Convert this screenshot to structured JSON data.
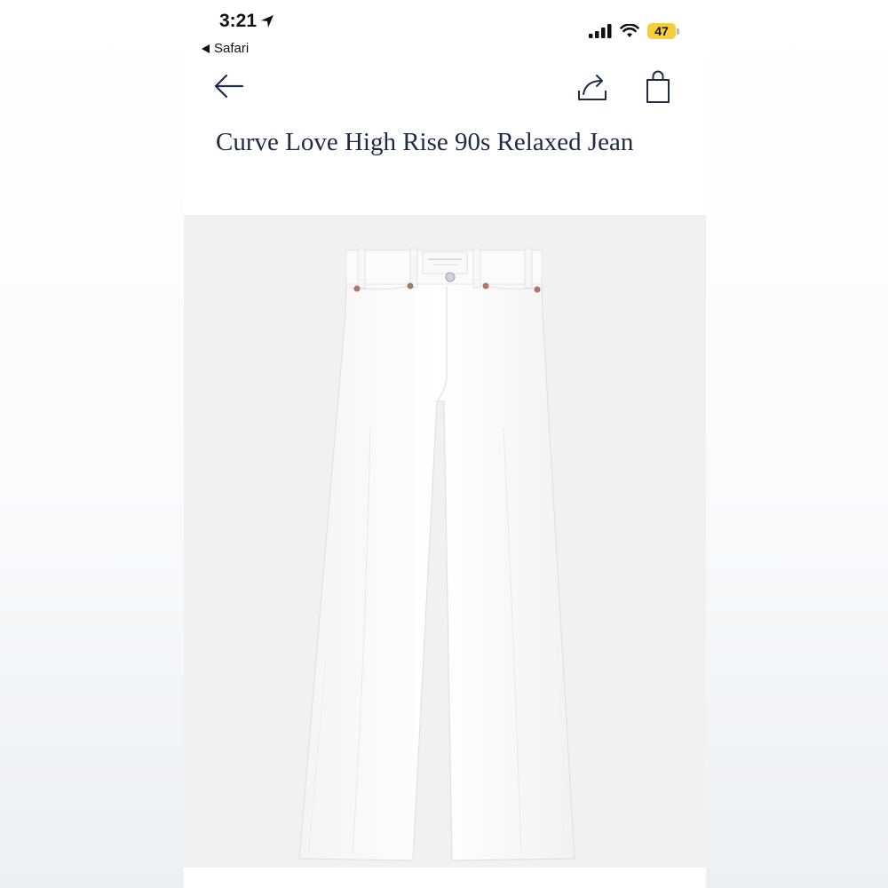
{
  "status_bar": {
    "time": "3:21",
    "back_app": "Safari",
    "battery": "47",
    "battery_color": "#f5cf3a"
  },
  "nav": {
    "back_icon": "arrow-left-icon",
    "share_icon": "share-icon",
    "bag_icon": "shopping-bag-icon"
  },
  "product": {
    "title": "Curve Love High Rise 90s Relaxed Jean",
    "image": "white-jeans-photo",
    "text_color": "#1d2b47"
  }
}
